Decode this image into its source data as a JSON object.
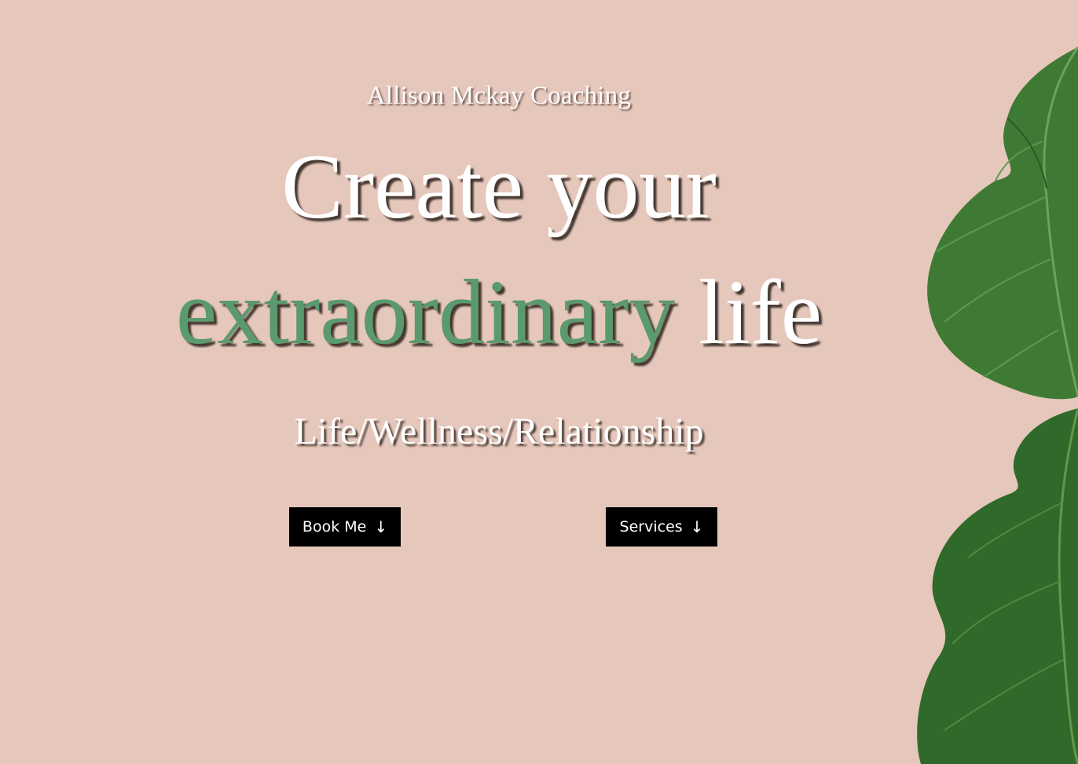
{
  "hero": {
    "brand": "Allison Mckay Coaching",
    "headline_line1": "Create your",
    "headline_accent": "extraordinary",
    "headline_end": "life",
    "tagline": "Life/Wellness/Relationship"
  },
  "buttons": {
    "book_label": "Book Me",
    "book_arrow": "↓",
    "services_label": "Services",
    "services_arrow": "↓"
  },
  "colors": {
    "background": "#e6c7bb",
    "accent_green": "#5a9a6e",
    "button_bg": "#000000",
    "leaf_dark": "#2f5e2a",
    "leaf_light": "#4f8a3e"
  },
  "decor": {
    "leaf_image": "monstera-leaf"
  }
}
